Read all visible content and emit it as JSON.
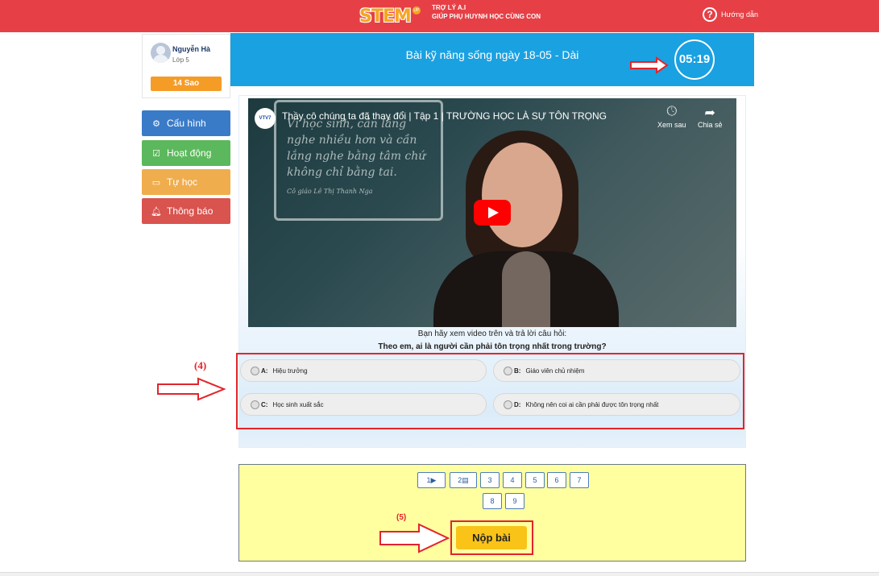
{
  "header": {
    "logo": "STEM",
    "logo_badge": "UP",
    "tagline_line1": "TRỢ LÝ A.I",
    "tagline_line2": "GIÚP PHỤ HUYNH HỌC CÙNG CON",
    "help_label": "Hướng dẫn",
    "help_icon": "question-circle-icon"
  },
  "profile": {
    "name": "Nguyễn Hà",
    "class": "Lớp 5",
    "stars": "14 Sao"
  },
  "sidebar": {
    "items": [
      {
        "label": "Cấu hình",
        "icon": "gear-icon",
        "color": "#3a7bc8"
      },
      {
        "label": "Hoạt động",
        "icon": "check-square-icon",
        "color": "#5cb85c"
      },
      {
        "label": "Tự học",
        "icon": "teacher-board-icon",
        "color": "#f0ad4e"
      },
      {
        "label": "Thông báo",
        "icon": "bell-icon",
        "color": "#d9534f"
      }
    ]
  },
  "lesson": {
    "title": "Bài kỹ năng sống ngày 18-05 - Dài",
    "timer": "05:19"
  },
  "video": {
    "channel": "VTV7",
    "title": "Thầy cô chúng ta đã thay đổi | Tập 1 | TRƯỜNG HỌC LÀ SỰ TÔN TRỌNG",
    "watch_later": "Xem sau",
    "share": "Chia sẻ",
    "chalk_text": "Vì học sinh, cần lắng nghe nhiều hơn và cần lắng nghe bằng tâm chứ không chỉ bằng tai.",
    "chalk_signature": "Cô giáo Lê Thị Thanh Nga"
  },
  "question": {
    "intro": "Bạn hãy xem video trên và trả lời câu hỏi:",
    "text": "Theo em, ai là người cần phải tôn trọng nhất trong trường?",
    "annotation": "(4)",
    "answers": [
      {
        "letter": "A:",
        "text": "Hiệu trưởng"
      },
      {
        "letter": "B:",
        "text": "Giáo viên chủ nhiệm"
      },
      {
        "letter": "C:",
        "text": "Học sinh xuất sắc"
      },
      {
        "letter": "D:",
        "text": "Không nên coi ai cần phải được tôn trọng nhất"
      }
    ]
  },
  "pagination": {
    "items": [
      "1",
      "2",
      "3",
      "4",
      "5",
      "6",
      "7",
      "8",
      "9"
    ],
    "item1_icon": "play-circle-icon",
    "item2_icon": "document-icon"
  },
  "submit": {
    "annotation": "(5)",
    "label": "Nộp bài"
  },
  "colors": {
    "topbar": "#e64046",
    "banner": "#1aa1e1",
    "annotation_red": "#e3242b",
    "submit_yellow": "#f9c318",
    "panel_yellow": "#ffffa0"
  }
}
